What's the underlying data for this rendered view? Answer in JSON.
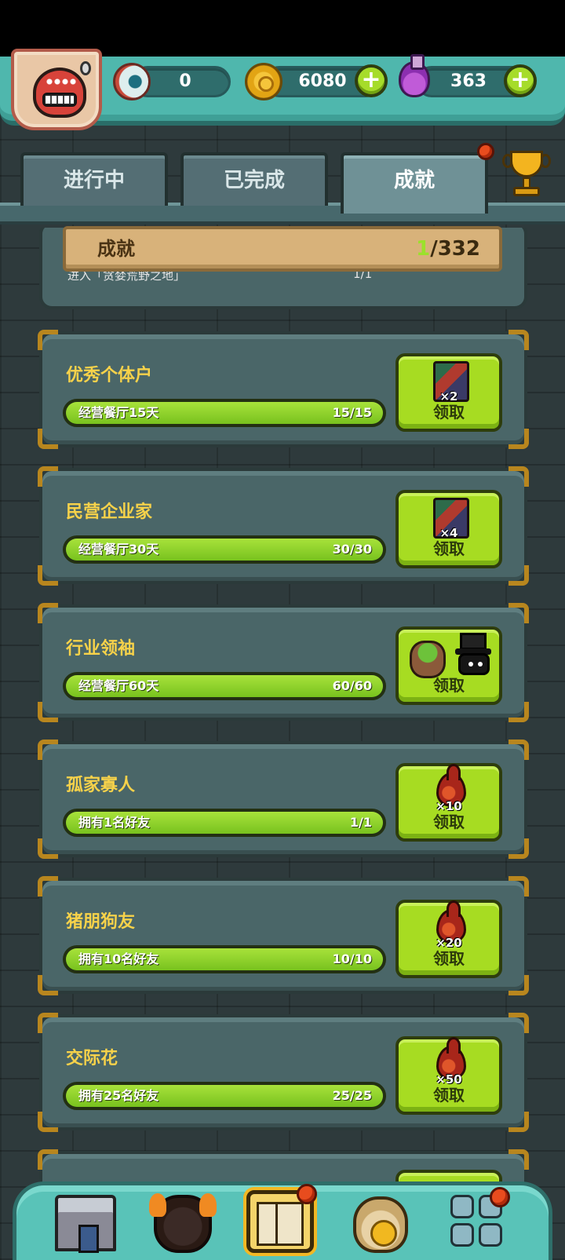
{
  "resources": {
    "eyes": "0",
    "coins": "6080",
    "potions": "363",
    "plus": "+"
  },
  "tabs": [
    {
      "label": "进行中"
    },
    {
      "label": "已完成"
    },
    {
      "label": "成就"
    }
  ],
  "summary": {
    "title": "成就",
    "done": "1",
    "total": "/332"
  },
  "previous_item": {
    "task": "进入「贪婪荒野之地」",
    "progress": "1/1"
  },
  "achievements": [
    {
      "title": "优秀个体户",
      "task": "经营餐厅15天",
      "progress": "15/15",
      "fill": 1.0,
      "reward": "card",
      "qty": "×2",
      "claim": "领取"
    },
    {
      "title": "民营企业家",
      "task": "经营餐厅30天",
      "progress": "30/30",
      "fill": 1.0,
      "reward": "card",
      "qty": "×4",
      "claim": "领取"
    },
    {
      "title": "行业领袖",
      "task": "经营餐厅60天",
      "progress": "60/60",
      "fill": 1.0,
      "reward": "bundle",
      "qty": "",
      "claim": "领取"
    },
    {
      "title": "孤家寡人",
      "task": "拥有1名好友",
      "progress": "1/1",
      "fill": 1.0,
      "reward": "drop",
      "qty": "×10",
      "claim": "领取"
    },
    {
      "title": "猪朋狗友",
      "task": "拥有10名好友",
      "progress": "10/10",
      "fill": 1.0,
      "reward": "drop",
      "qty": "×20",
      "claim": "领取"
    },
    {
      "title": "交际花",
      "task": "拥有25名好友",
      "progress": "25/25",
      "fill": 1.0,
      "reward": "drop",
      "qty": "×50",
      "claim": "领取"
    }
  ],
  "icons": {
    "avatar": "monster-avatar-icon",
    "eye": "eyeball-icon",
    "coin": "gold-coin-icon",
    "potion": "purple-potion-icon",
    "trophy": "trophy-icon",
    "nav": [
      "restaurant-icon",
      "monster-icon",
      "book-icon",
      "money-bag-icon",
      "grid-menu-icon"
    ]
  },
  "colors": {
    "accent_green": "#a7dc22",
    "title_yellow": "#f7d24a",
    "teal": "#4fb7ad",
    "notification_red": "#e84c1e"
  }
}
